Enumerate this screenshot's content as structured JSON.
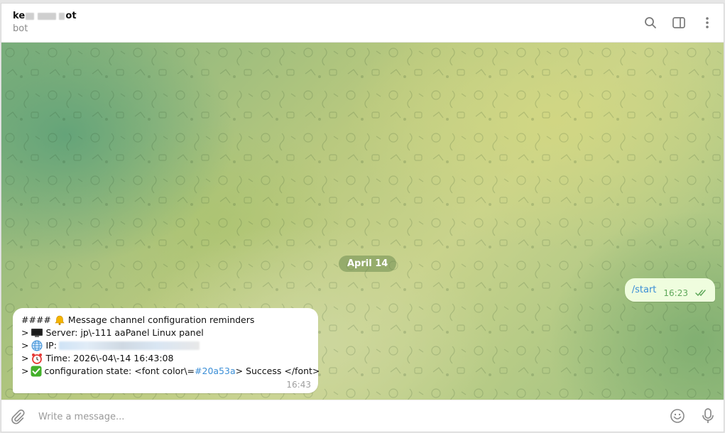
{
  "header": {
    "title_visible_start": "ke",
    "title_visible_end": "ot",
    "subtitle": "bot",
    "icons": [
      "search-icon",
      "sidebar-toggle-icon",
      "more-vertical-icon"
    ]
  },
  "chat": {
    "date_separator": "April 14",
    "outgoing": {
      "text": "/start",
      "time": "16:23",
      "status": "read"
    },
    "incoming": {
      "line1_prefix": "####",
      "line1_text": "Message channel configuration reminders",
      "line2_prefix": ">",
      "line2_text": "Server: jp\\-111 aaPanel Linux panel",
      "line3_prefix": ">",
      "line3_label": "IP:",
      "line4_prefix": ">",
      "line4_text": "Time: 2026\\-04\\-14 16:43:08",
      "line5_prefix": ">",
      "line5_text_a": "configuration state: <font color\\=",
      "line5_color_link": "#20a53a",
      "line5_text_b": "> Success </font>",
      "time": "16:43",
      "icons": [
        "bell-icon",
        "monitor-icon",
        "globe-icon",
        "alarm-clock-icon",
        "check-mark-icon"
      ]
    }
  },
  "composer": {
    "placeholder": "Write a message...",
    "icons": [
      "paperclip-icon",
      "emoji-icon",
      "microphone-icon"
    ]
  },
  "colors": {
    "link": "#3a8ed6",
    "outgoing_bubble": "#effdde",
    "read_check": "#5fa85a"
  }
}
